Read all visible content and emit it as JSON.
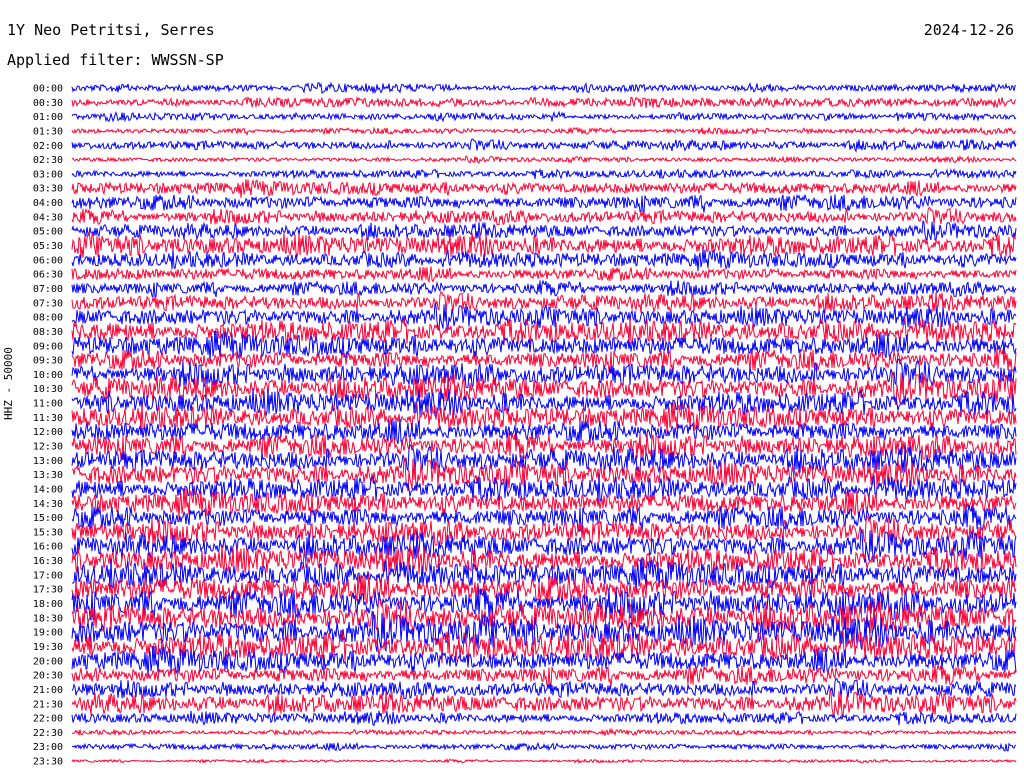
{
  "header": {
    "station": "1Y Neo Petritsi, Serres",
    "date": "2024-12-26",
    "filter": "Applied filter: WWSSN-SP"
  },
  "colors": {
    "trace_a": "#ff0033",
    "trace_b": "#0000ff",
    "background": "#ffffff"
  },
  "chart_data": {
    "type": "line",
    "subtype": "helicorder",
    "ylabel": "HHZ - 50000",
    "series": [
      {
        "time": "00:00",
        "color": "#0000ff",
        "amplitude": 0.35
      },
      {
        "time": "00:30",
        "color": "#ff0033",
        "amplitude": 0.4
      },
      {
        "time": "01:00",
        "color": "#0000ff",
        "amplitude": 0.3
      },
      {
        "time": "01:30",
        "color": "#ff0033",
        "amplitude": 0.25
      },
      {
        "time": "02:00",
        "color": "#0000ff",
        "amplitude": 0.4
      },
      {
        "time": "02:30",
        "color": "#ff0033",
        "amplitude": 0.2
      },
      {
        "time": "03:00",
        "color": "#0000ff",
        "amplitude": 0.35
      },
      {
        "time": "03:30",
        "color": "#ff0033",
        "amplitude": 0.6
      },
      {
        "time": "04:00",
        "color": "#0000ff",
        "amplitude": 0.7
      },
      {
        "time": "04:30",
        "color": "#ff0033",
        "amplitude": 0.6
      },
      {
        "time": "05:00",
        "color": "#0000ff",
        "amplitude": 0.6
      },
      {
        "time": "05:30",
        "color": "#ff0033",
        "amplitude": 0.9
      },
      {
        "time": "06:00",
        "color": "#0000ff",
        "amplitude": 0.7
      },
      {
        "time": "06:30",
        "color": "#ff0033",
        "amplitude": 0.6
      },
      {
        "time": "07:00",
        "color": "#0000ff",
        "amplitude": 0.6
      },
      {
        "time": "07:30",
        "color": "#ff0033",
        "amplitude": 0.7
      },
      {
        "time": "08:00",
        "color": "#0000ff",
        "amplitude": 0.8
      },
      {
        "time": "08:30",
        "color": "#ff0033",
        "amplitude": 1.0
      },
      {
        "time": "09:00",
        "color": "#0000ff",
        "amplitude": 1.0
      },
      {
        "time": "09:30",
        "color": "#ff0033",
        "amplitude": 0.9
      },
      {
        "time": "10:00",
        "color": "#0000ff",
        "amplitude": 1.0
      },
      {
        "time": "10:30",
        "color": "#ff0033",
        "amplitude": 1.0
      },
      {
        "time": "11:00",
        "color": "#0000ff",
        "amplitude": 1.0
      },
      {
        "time": "11:30",
        "color": "#ff0033",
        "amplitude": 1.0
      },
      {
        "time": "12:00",
        "color": "#0000ff",
        "amplitude": 1.0
      },
      {
        "time": "12:30",
        "color": "#ff0033",
        "amplitude": 1.0
      },
      {
        "time": "13:00",
        "color": "#0000ff",
        "amplitude": 1.0
      },
      {
        "time": "13:30",
        "color": "#ff0033",
        "amplitude": 1.0
      },
      {
        "time": "14:00",
        "color": "#0000ff",
        "amplitude": 1.0
      },
      {
        "time": "14:30",
        "color": "#ff0033",
        "amplitude": 1.0
      },
      {
        "time": "15:00",
        "color": "#0000ff",
        "amplitude": 1.0
      },
      {
        "time": "15:30",
        "color": "#ff0033",
        "amplitude": 1.0
      },
      {
        "time": "16:00",
        "color": "#0000ff",
        "amplitude": 1.0
      },
      {
        "time": "16:30",
        "color": "#ff0033",
        "amplitude": 1.1
      },
      {
        "time": "17:00",
        "color": "#0000ff",
        "amplitude": 1.1
      },
      {
        "time": "17:30",
        "color": "#ff0033",
        "amplitude": 1.2
      },
      {
        "time": "18:00",
        "color": "#0000ff",
        "amplitude": 1.2
      },
      {
        "time": "18:30",
        "color": "#ff0033",
        "amplitude": 1.2
      },
      {
        "time": "19:00",
        "color": "#0000ff",
        "amplitude": 1.2
      },
      {
        "time": "19:30",
        "color": "#ff0033",
        "amplitude": 1.2
      },
      {
        "time": "20:00",
        "color": "#0000ff",
        "amplitude": 1.0
      },
      {
        "time": "20:30",
        "color": "#ff0033",
        "amplitude": 0.8
      },
      {
        "time": "21:00",
        "color": "#0000ff",
        "amplitude": 0.7
      },
      {
        "time": "21:30",
        "color": "#ff0033",
        "amplitude": 0.8
      },
      {
        "time": "22:00",
        "color": "#0000ff",
        "amplitude": 0.5
      },
      {
        "time": "22:30",
        "color": "#ff0033",
        "amplitude": 0.2
      },
      {
        "time": "23:00",
        "color": "#0000ff",
        "amplitude": 0.3
      },
      {
        "time": "23:30",
        "color": "#ff0033",
        "amplitude": 0.12
      }
    ]
  }
}
